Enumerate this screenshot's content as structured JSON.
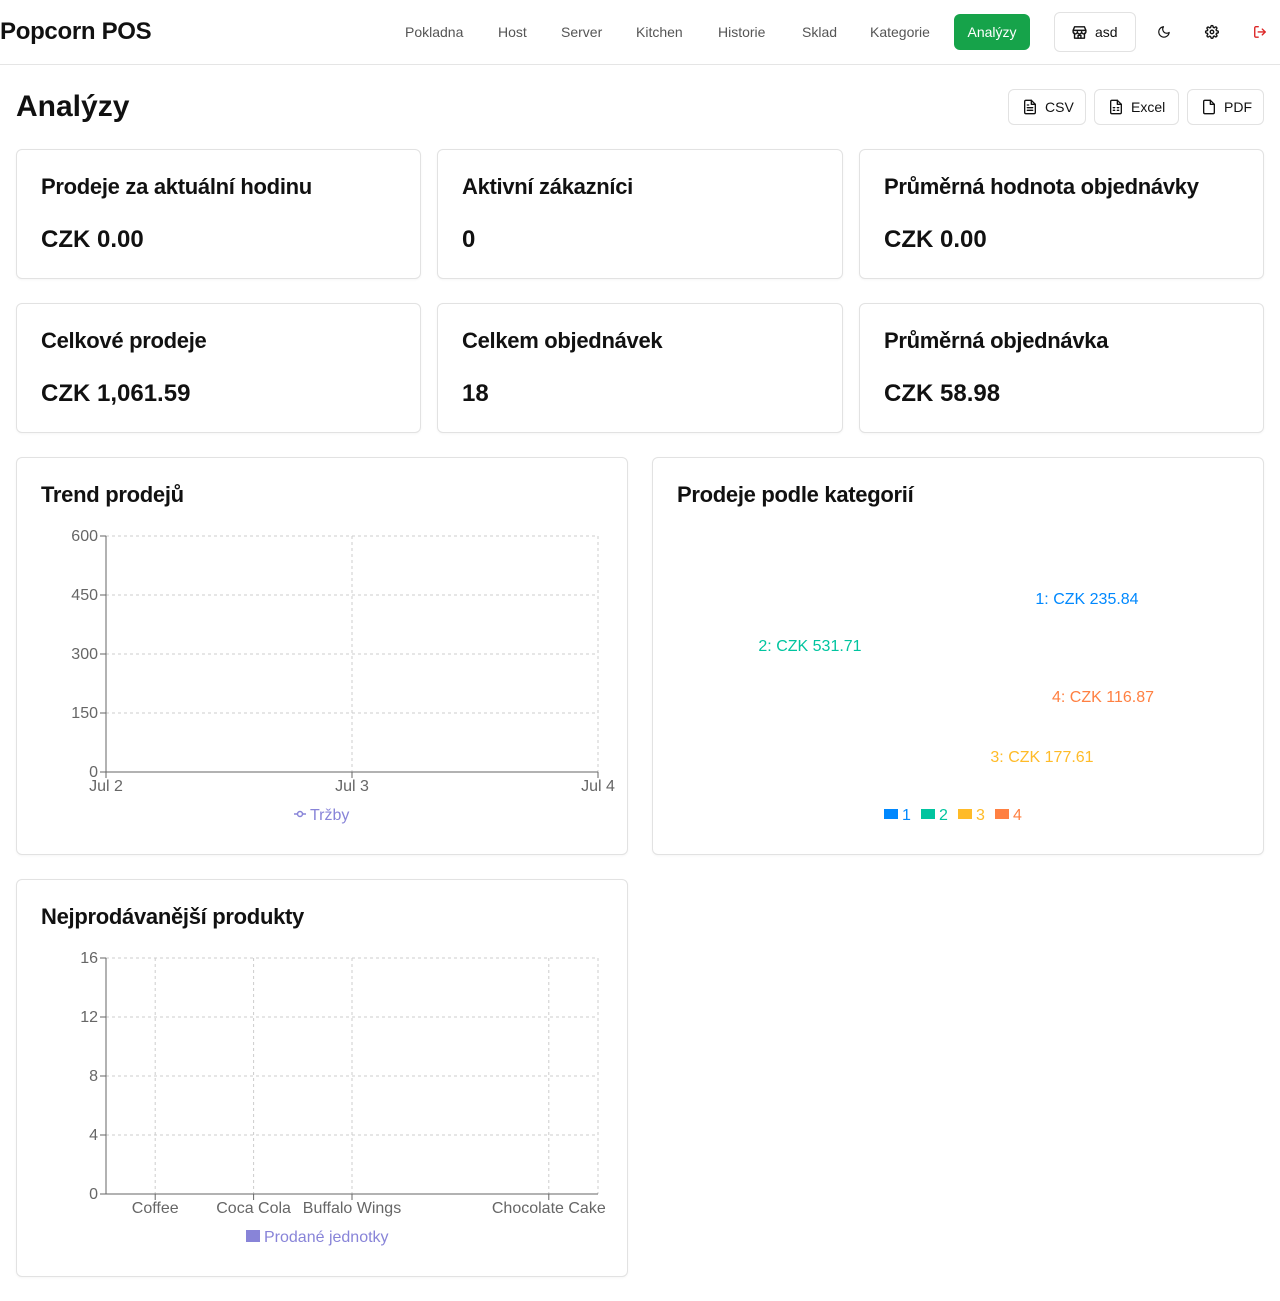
{
  "app": {
    "name": "Popcorn POS"
  },
  "nav": {
    "items": [
      {
        "key": "pokladna",
        "label": "Pokladna"
      },
      {
        "key": "host",
        "label": "Host"
      },
      {
        "key": "server",
        "label": "Server"
      },
      {
        "key": "kitchen",
        "label": "Kitchen"
      },
      {
        "key": "historie",
        "label": "Historie"
      },
      {
        "key": "sklad",
        "label": "Sklad"
      },
      {
        "key": "kategorie",
        "label": "Kategorie"
      },
      {
        "key": "analyzy",
        "label": "Analýzy",
        "active": true
      }
    ],
    "store_label": "asd",
    "icons": [
      "store-icon",
      "moon-icon",
      "gear-icon",
      "logout-icon"
    ]
  },
  "page": {
    "title": "Analýzy",
    "exports": [
      {
        "label": "CSV",
        "icon": "file-text-icon"
      },
      {
        "label": "Excel",
        "icon": "file-spreadsheet-icon"
      },
      {
        "label": "PDF",
        "icon": "file-icon"
      }
    ]
  },
  "stats": [
    {
      "title": "Prodeje za aktuální hodinu",
      "value": "CZK 0.00"
    },
    {
      "title": "Aktivní zákazníci",
      "value": "0"
    },
    {
      "title": "Průměrná hodnota objednávky",
      "value": "CZK 0.00"
    },
    {
      "title": "Celkové prodeje",
      "value": "CZK 1,061.59"
    },
    {
      "title": "Celkem objednávek",
      "value": "18"
    },
    {
      "title": "Průměrná objednávka",
      "value": "CZK 58.98"
    }
  ],
  "colors": {
    "accent": "#16a34a",
    "series_purple": "#8884d8",
    "cat1": "#0088FE",
    "cat2": "#00C49F",
    "cat3": "#FFBB28",
    "cat4": "#FF8042",
    "logout": "#dc2626"
  },
  "chart_data": [
    {
      "id": "trend",
      "type": "line",
      "title": "Trend prodejů",
      "x": [
        "Jul 2",
        "Jul 3",
        "Jul 4"
      ],
      "series": [
        {
          "name": "Tržby",
          "values": []
        }
      ],
      "ylim": [
        0,
        600
      ],
      "yticks": [
        "0",
        "150",
        "300",
        "450",
        "600"
      ],
      "grid": true,
      "legend": "bottom"
    },
    {
      "id": "categories",
      "type": "pie",
      "title": "Prodeje podle kategorií",
      "slices": [
        {
          "name": "1",
          "value": 235.84,
          "label": "1: CZK 235.84"
        },
        {
          "name": "2",
          "value": 531.71,
          "label": "2: CZK 531.71"
        },
        {
          "name": "3",
          "value": 177.61,
          "label": "3: CZK 177.61"
        },
        {
          "name": "4",
          "value": 116.87,
          "label": "4: CZK 116.87"
        }
      ],
      "legend": "bottom"
    },
    {
      "id": "products",
      "type": "bar",
      "title": "Nejprodávanější produkty",
      "categories": [
        "Coffee",
        "Coca Cola",
        "Buffalo Wings",
        "Chocolate Cake"
      ],
      "series": [
        {
          "name": "Prodané jednotky",
          "values": []
        }
      ],
      "ylim": [
        0,
        16
      ],
      "yticks": [
        "0",
        "4",
        "8",
        "12",
        "16"
      ],
      "grid": true,
      "legend": "bottom"
    }
  ]
}
